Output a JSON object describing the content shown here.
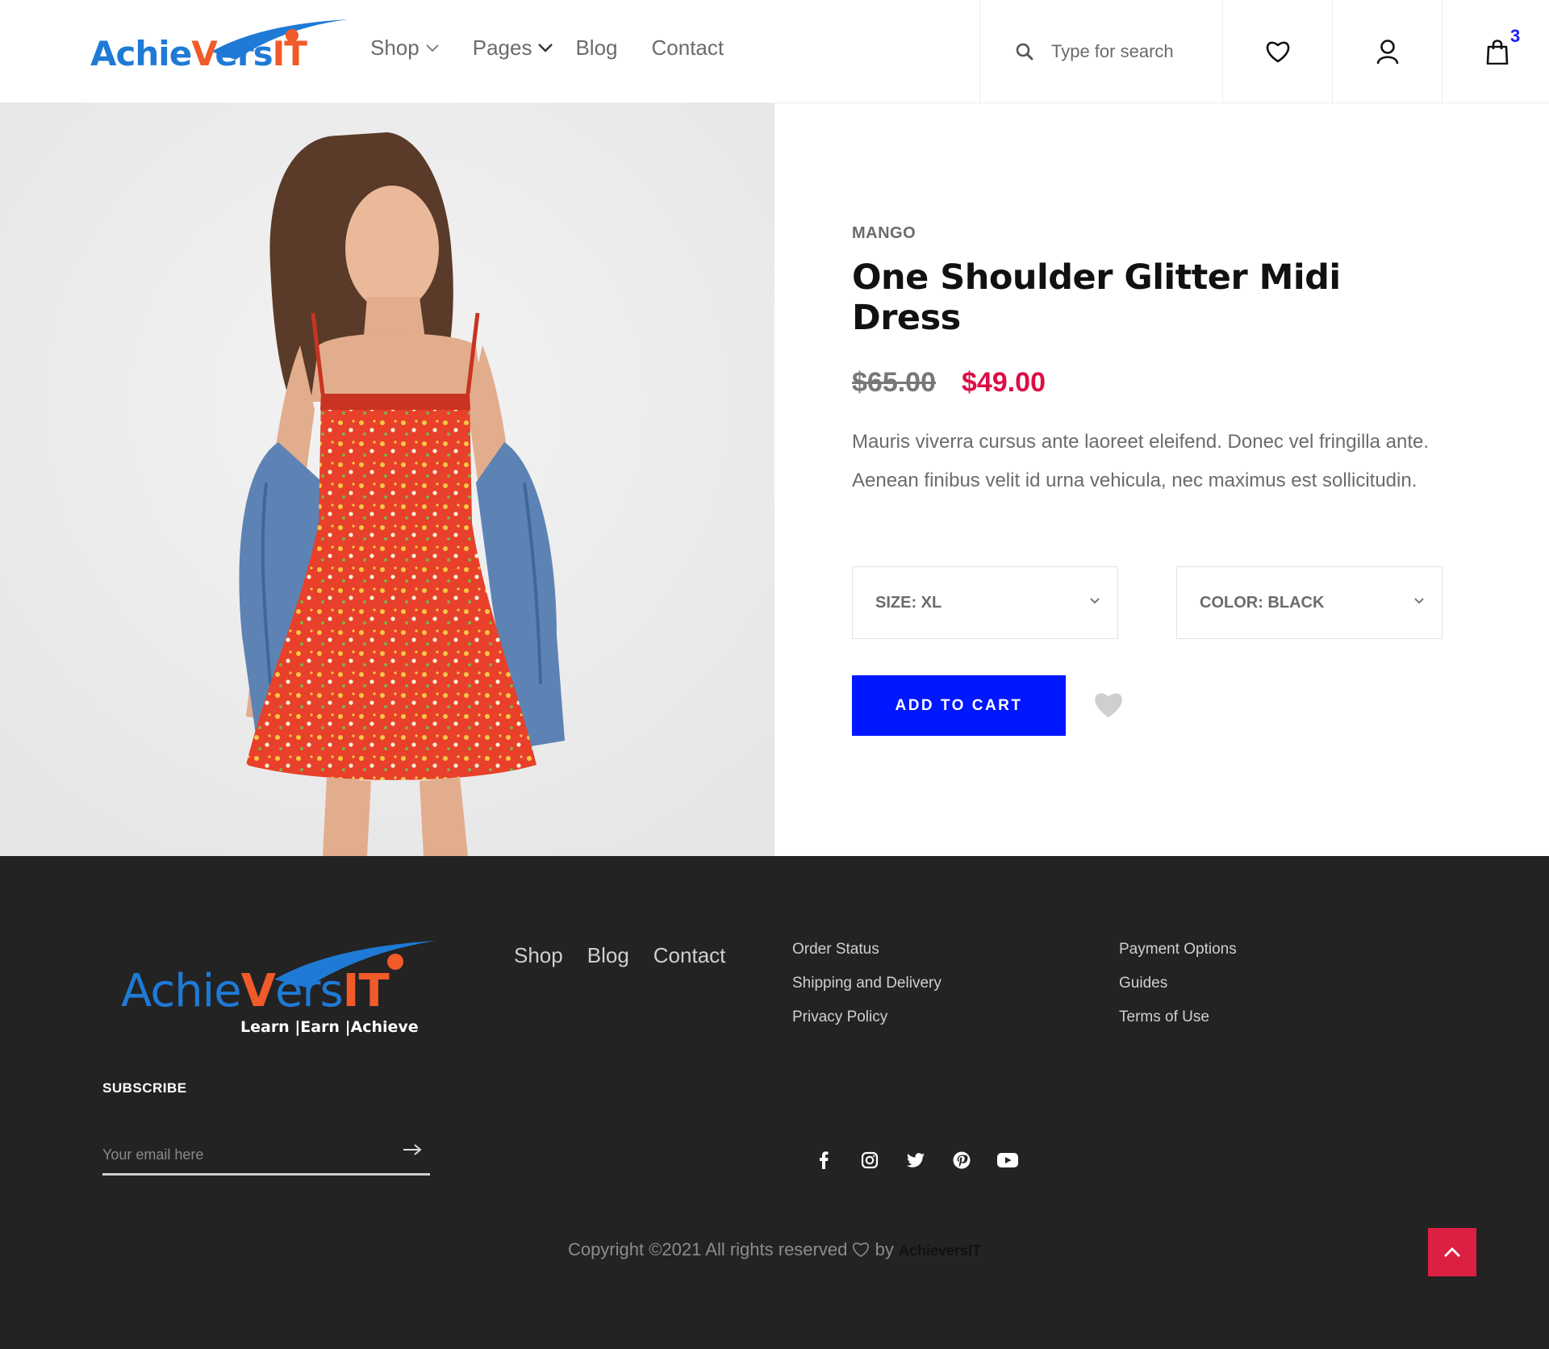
{
  "header": {
    "logo_text_blue_1": "Achie",
    "logo_text_orange": "V",
    "logo_text_blue_2": "ers",
    "logo_text_orange_2": "IT",
    "nav": [
      {
        "label": "Shop",
        "has_dropdown": true
      },
      {
        "label": "Pages",
        "has_dropdown": true
      },
      {
        "label": "Blog",
        "has_dropdown": false
      },
      {
        "label": "Contact",
        "has_dropdown": false
      }
    ],
    "search_placeholder": "Type for search",
    "cart_count": "3",
    "icons": [
      "search-icon",
      "heart-icon",
      "user-icon",
      "shopping-bag-icon"
    ]
  },
  "product": {
    "brand": "MANGO",
    "title": "One Shoulder Glitter Midi Dress",
    "old_price": "$65.00",
    "new_price": "$49.00",
    "description": "Mauris viverra cursus ante laoreet eleifend. Donec vel fringilla ante. Aenean finibus velit id urna vehicula, nec maximus est sollicitudin.",
    "size_select": "SIZE: XL",
    "color_select": "COLOR: BLACK",
    "add_to_cart": "ADD TO CART",
    "image_alt": "woman in red floral dress with denim jacket"
  },
  "footer": {
    "logo_text_blue_1": "Achie",
    "logo_text_orange": "V",
    "logo_text_blue_2": "ers",
    "logo_text_orange_2": "IT",
    "tagline": "Learn |Earn |Achieve",
    "nav": [
      "Shop",
      "Blog",
      "Contact"
    ],
    "links_col1": [
      "Order Status",
      "Shipping and Delivery",
      "Privacy Policy"
    ],
    "links_col2": [
      "Payment Options",
      "Guides",
      "Terms of Use"
    ],
    "subscribe_title": "SUBSCRIBE",
    "email_placeholder": "Your email here",
    "socials": [
      "facebook-icon",
      "instagram-icon",
      "twitter-icon",
      "pinterest-icon",
      "youtube-icon"
    ],
    "copyright_prefix": "Copyright ©2021 All rights reserved",
    "copyright_by": "by",
    "copyright_brand": "AchieversIT"
  },
  "colors": {
    "accent_blue": "#0017ff",
    "price_red": "#dc0d45",
    "footer_bg": "#232323",
    "back_to_top": "#dc2044",
    "logo_blue": "#1f7ad6",
    "logo_orange": "#f15a29"
  }
}
